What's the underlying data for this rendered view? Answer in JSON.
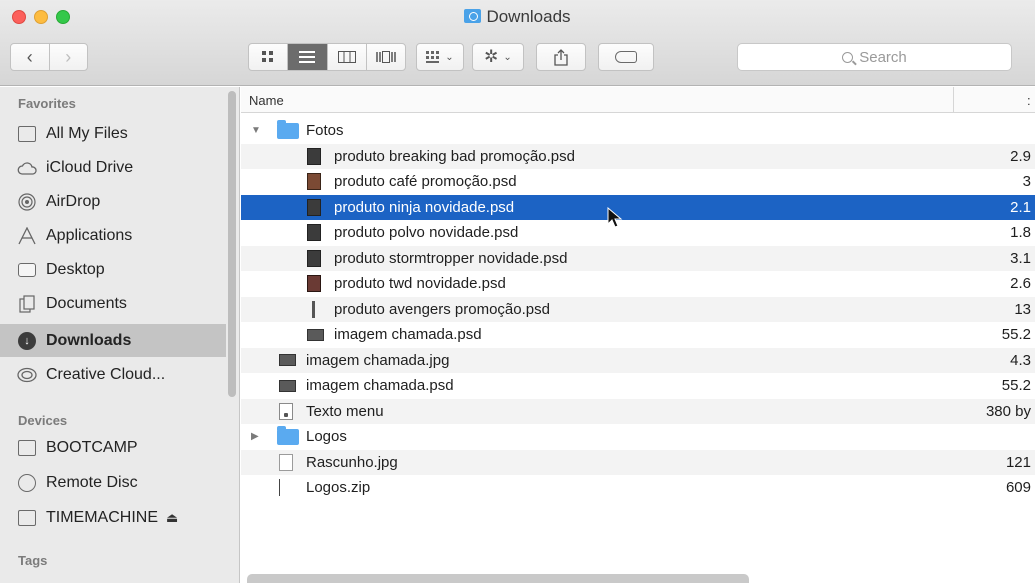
{
  "window": {
    "title": "Downloads"
  },
  "toolbar": {
    "back": "‹",
    "forward": "›",
    "views": [
      "icon",
      "list",
      "column",
      "coverflow"
    ],
    "search_placeholder": "Search"
  },
  "sidebar": {
    "favorites_label": "Favorites",
    "favorites": [
      {
        "label": "All My Files",
        "icon": "all-files-icon"
      },
      {
        "label": "iCloud Drive",
        "icon": "cloud-icon"
      },
      {
        "label": "AirDrop",
        "icon": "airdrop-icon"
      },
      {
        "label": "Applications",
        "icon": "applications-icon"
      },
      {
        "label": "Desktop",
        "icon": "desktop-icon"
      },
      {
        "label": "Documents",
        "icon": "documents-icon"
      },
      {
        "label": "Downloads",
        "icon": "downloads-icon",
        "selected": true
      },
      {
        "label": "Creative Cloud...",
        "icon": "creative-cloud-icon"
      }
    ],
    "devices_label": "Devices",
    "devices": [
      {
        "label": "BOOTCAMP",
        "icon": "drive-icon"
      },
      {
        "label": "Remote Disc",
        "icon": "disc-icon"
      },
      {
        "label": "TIMEMACHINE",
        "icon": "timemachine-icon",
        "eject": "⏏"
      }
    ],
    "tags_label": "Tags"
  },
  "list": {
    "header_name": "Name",
    "header_col2": ":",
    "rows": [
      {
        "name": "Fotos",
        "size": "",
        "level": 0,
        "icon": "folder",
        "expanded": true
      },
      {
        "name": "produto breaking bad promoção.psd",
        "size": "2.9",
        "level": 1,
        "icon": "psd-dark"
      },
      {
        "name": "produto café promoção.psd",
        "size": "3",
        "level": 1,
        "icon": "psd-brown"
      },
      {
        "name": "produto ninja novidade.psd",
        "size": "2.1",
        "level": 1,
        "icon": "psd-dark",
        "selected": true
      },
      {
        "name": "produto polvo novidade.psd",
        "size": "1.8",
        "level": 1,
        "icon": "psd-dark"
      },
      {
        "name": "produto stormtropper novidade.psd",
        "size": "3.1",
        "level": 1,
        "icon": "psd-dark"
      },
      {
        "name": "produto twd novidade.psd",
        "size": "2.6",
        "level": 1,
        "icon": "psd-red"
      },
      {
        "name": "produto avengers promoção.psd",
        "size": "13",
        "level": 1,
        "icon": "thin"
      },
      {
        "name": "imagem chamada.psd",
        "size": "55.2",
        "level": 1,
        "icon": "img"
      },
      {
        "name": "imagem chamada.jpg",
        "size": "4.3",
        "level": 0,
        "icon": "img"
      },
      {
        "name": "imagem chamada.psd",
        "size": "55.2",
        "level": 0,
        "icon": "img"
      },
      {
        "name": "Texto menu",
        "size": "380 by",
        "level": 0,
        "icon": "txt"
      },
      {
        "name": "Logos",
        "size": "",
        "level": 0,
        "icon": "folder",
        "expanded": false
      },
      {
        "name": "Rascunho.jpg",
        "size": "121",
        "level": 0,
        "icon": "doc"
      },
      {
        "name": "Logos.zip",
        "size": "609",
        "level": 0,
        "icon": "zip"
      }
    ]
  }
}
